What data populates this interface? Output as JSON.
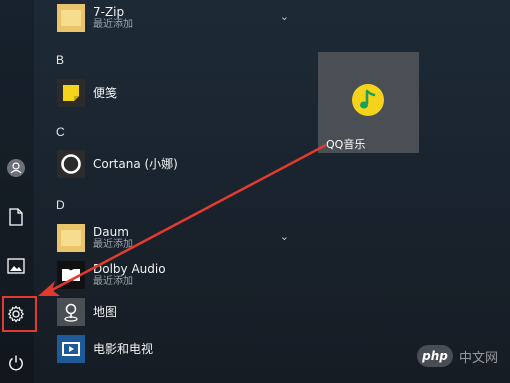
{
  "app_list": {
    "items_top": {
      "name": "7-Zip",
      "sub": "最近添加"
    },
    "section_b": "B",
    "sticky_notes": {
      "name": "便笺"
    },
    "section_c": "C",
    "cortana": {
      "name": "Cortana (小娜)"
    },
    "section_d": "D",
    "daum": {
      "name": "Daum",
      "sub": "最近添加"
    },
    "dolby": {
      "name": "Dolby Audio",
      "sub": "最近添加"
    },
    "maps": {
      "name": "地图"
    },
    "movies": {
      "name": "电影和电视"
    }
  },
  "tile": {
    "label": "QQ音乐"
  },
  "rail": {
    "icons": [
      "user-icon",
      "document-icon",
      "pictures-icon",
      "settings-icon",
      "power-icon"
    ]
  },
  "watermark": {
    "logo_text": "php",
    "text": "中文网"
  },
  "colors": {
    "accent_red": "#e23a2e",
    "tile_bg": "#4a4f55",
    "qq_yellow": "#f5d31b",
    "folder_yellow": "#e9c46a"
  }
}
